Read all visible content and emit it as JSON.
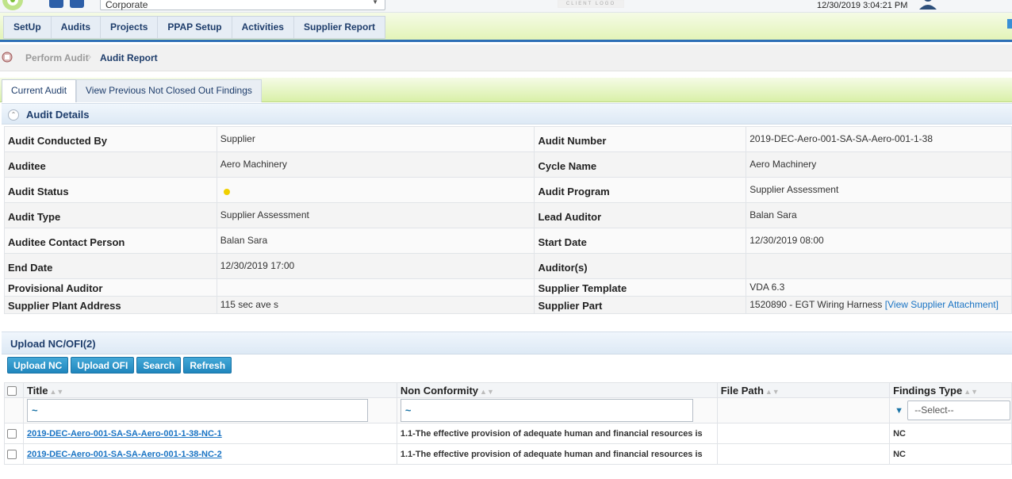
{
  "header": {
    "org_select_value": "Corporate",
    "client_logo_text": "CLIENT LOGO",
    "datetime": "12/30/2019 3:04:21 PM"
  },
  "nav": {
    "items": [
      "SetUp",
      "Audits",
      "Projects",
      "PPAP Setup",
      "Activities",
      "Supplier Report"
    ]
  },
  "breadcrumb": {
    "items": [
      "Perform Audit",
      "Audit Report"
    ]
  },
  "tabs": {
    "current": "Current Audit",
    "previous": "View Previous Not Closed Out Findings"
  },
  "audit_details": {
    "title": "Audit Details",
    "rows": [
      {
        "l1": "Audit Conducted By",
        "v1": "Supplier",
        "l2": "Audit Number",
        "v2": "2019-DEC-Aero-001-SA-SA-Aero-001-1-38"
      },
      {
        "l1": "Auditee",
        "v1": "Aero Machinery",
        "l2": "Cycle Name",
        "v2": "Aero Machinery"
      },
      {
        "l1": "Audit Status",
        "v1": "",
        "l2": "Audit Program",
        "v2": "Supplier Assessment"
      },
      {
        "l1": "Audit Type",
        "v1": "Supplier Assessment",
        "l2": "Lead Auditor",
        "v2": "Balan Sara"
      },
      {
        "l1": "Auditee Contact Person",
        "v1": "Balan Sara",
        "l2": "Start Date",
        "v2": "12/30/2019 08:00"
      },
      {
        "l1": "End Date",
        "v1": "12/30/2019 17:00",
        "l2": "Auditor(s)",
        "v2": ""
      },
      {
        "l1": "Provisional Auditor",
        "v1": "",
        "l2": "Supplier Template",
        "v2": "VDA 6.3"
      },
      {
        "l1": "Supplier Plant Address",
        "v1": "115 sec ave s",
        "l2": "Supplier Part",
        "v2": "1520890 - EGT Wiring Harness",
        "v2_link": "[View Supplier Attachment]"
      }
    ],
    "status_color": "#f0d000"
  },
  "upload": {
    "title": "Upload NC/OFI(2)",
    "buttons": [
      "Upload NC",
      "Upload OFI",
      "Search",
      "Refresh"
    ],
    "columns": [
      "Title",
      "Non Conformity",
      "File Path",
      "Findings Type"
    ],
    "filter_title": "~",
    "filter_nc": "~",
    "filter_type_select": "--Select--",
    "rows": [
      {
        "title": "2019-DEC-Aero-001-SA-SA-Aero-001-1-38-NC-1",
        "non_conformity": "1.1-The effective provision of adequate human and financial resources is",
        "file_path": "",
        "type": "NC"
      },
      {
        "title": "2019-DEC-Aero-001-SA-SA-Aero-001-1-38-NC-2",
        "non_conformity": "1.1-The effective provision of adequate human and financial resources is",
        "file_path": "",
        "type": "NC"
      }
    ]
  }
}
